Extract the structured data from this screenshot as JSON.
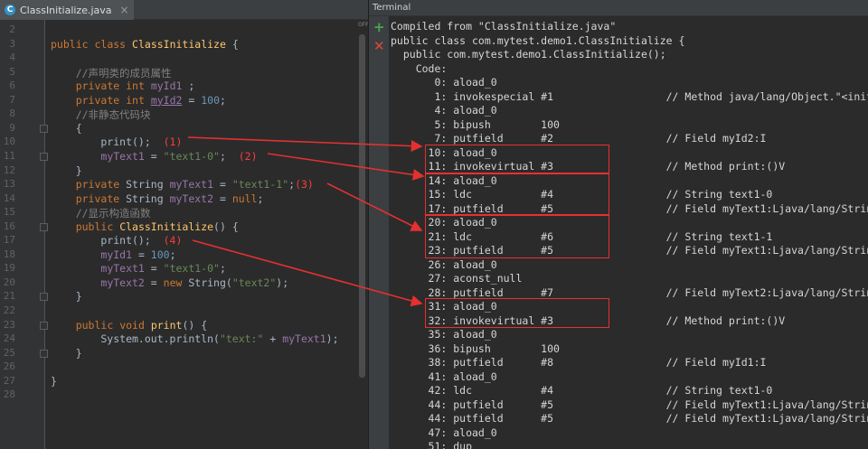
{
  "editor": {
    "tab": {
      "icon": "c-icon",
      "icon_letter": "C",
      "filename": "ClassInitialize.java",
      "close": "×"
    },
    "status_off": "OFF",
    "first_line_number": 2,
    "lines": [
      "",
      "public class ClassInitialize {",
      "",
      "    //声明类的成员属性",
      "    private int myId1 ;",
      "    private int myId2 = 100;",
      "    //非静态代码块",
      "    {",
      "        print();  (1)",
      "        myText1 = \"text1-0\";  (2)",
      "    }",
      "    private String myText1 = \"text1-1\";(3)",
      "    private String myText2 = null;",
      "    //显示构造函数",
      "    public ClassInitialize() {",
      "        print();  (4)",
      "        myId1 = 100;",
      "        myText1 = \"text1-0\";",
      "        myText2 = new String(\"text2\");",
      "    }",
      "",
      "    public void print() {",
      "        System.out.println(\"text:\" + myText1);",
      "    }",
      "",
      "}",
      ""
    ]
  },
  "terminal": {
    "title": "Terminal",
    "new_session_icon": "plus-icon",
    "close_session_icon": "close-icon",
    "lines": [
      "Compiled from \"ClassInitialize.java\"",
      "public class com.mytest.demo1.ClassInitialize {",
      "  public com.mytest.demo1.ClassInitialize();",
      "    Code:",
      "       0: aload_0",
      "       1: invokespecial #1                  // Method java/lang/Object.\"<init>\":()V",
      "       4: aload_0",
      "       5: bipush        100",
      "       7: putfield      #2                  // Field myId2:I",
      "      10: aload_0",
      "      11: invokevirtual #3                  // Method print:()V",
      "      14: aload_0",
      "      15: ldc           #4                  // String text1-0",
      "      17: putfield      #5                  // Field myText1:Ljava/lang/String;",
      "      20: aload_0",
      "      21: ldc           #6                  // String text1-1",
      "      23: putfield      #5                  // Field myText1:Ljava/lang/String;",
      "      26: aload_0",
      "      27: aconst_null",
      "      28: putfield      #7                  // Field myText2:Ljava/lang/String;",
      "      31: aload_0",
      "      32: invokevirtual #3                  // Method print:()V",
      "      35: aload_0",
      "      36: bipush        100",
      "      38: putfield      #8                  // Field myId1:I",
      "      41: aload_0",
      "      42: ldc           #4                  // String text1-0",
      "      44: putfield      #5                  // Field myText1:Ljava/lang/String;",
      "      44: putfield      #5                  // Field myText1:Ljava/lang/String;",
      "      47: aload_0",
      "      51: dup"
    ]
  },
  "colors": {
    "annotation": "#e63030",
    "background": "#2b2b2b"
  }
}
